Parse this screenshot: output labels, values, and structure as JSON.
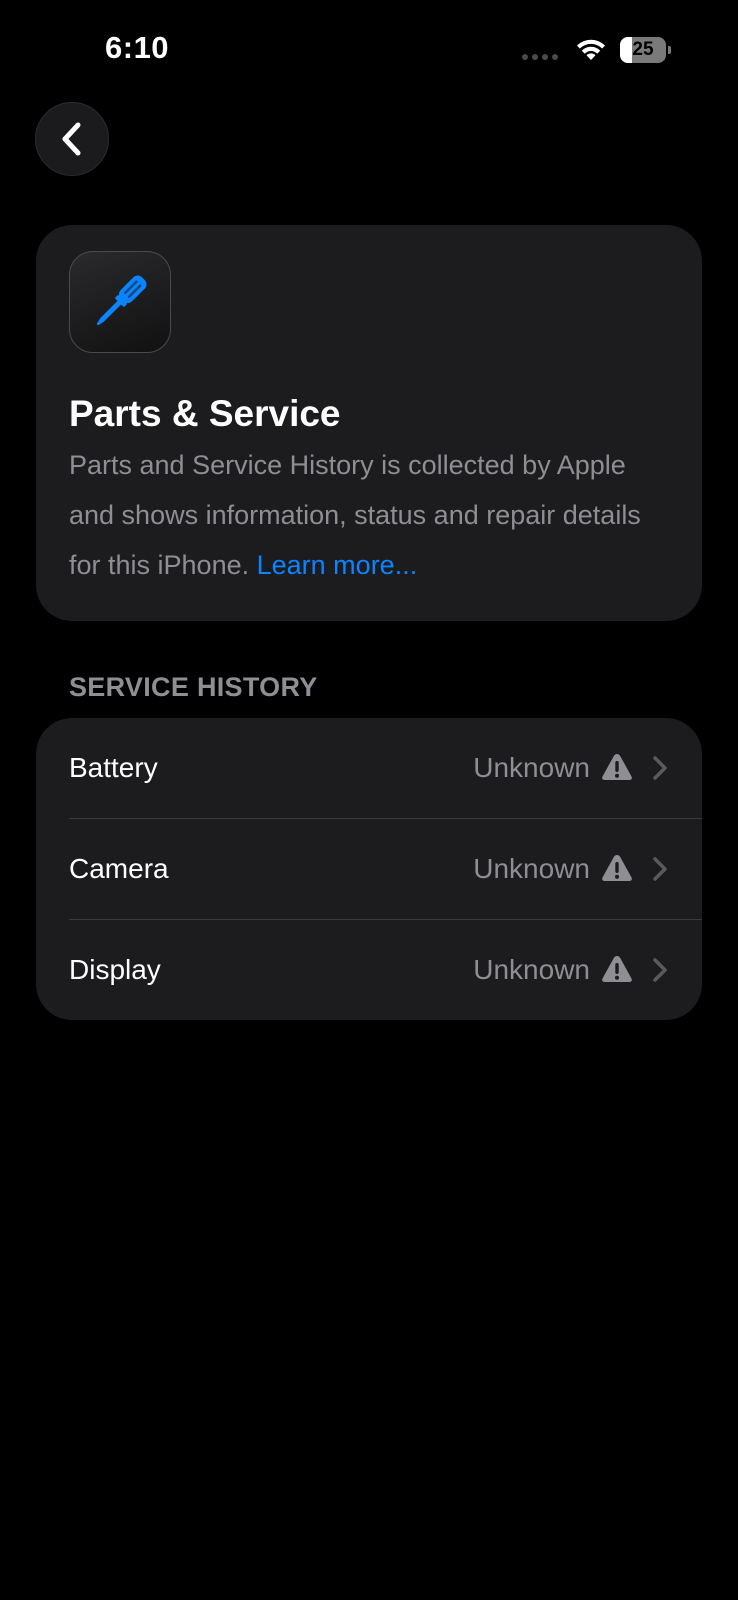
{
  "status_bar": {
    "time": "6:10",
    "battery_percent": "25",
    "battery_level": 0.25
  },
  "header": {
    "title": "Parts & Service",
    "description": "Parts and Service History is collected by Apple and shows information, status and repair details for this iPhone.",
    "learn_more": "Learn more..."
  },
  "service_history": {
    "section_title": "SERVICE HISTORY",
    "items": [
      {
        "label": "Battery",
        "value": "Unknown"
      },
      {
        "label": "Camera",
        "value": "Unknown"
      },
      {
        "label": "Display",
        "value": "Unknown"
      }
    ]
  },
  "colors": {
    "background": "#000000",
    "card": "#1c1c1e",
    "accent": "#0a84ff",
    "secondary_text": "#8e8e93"
  }
}
